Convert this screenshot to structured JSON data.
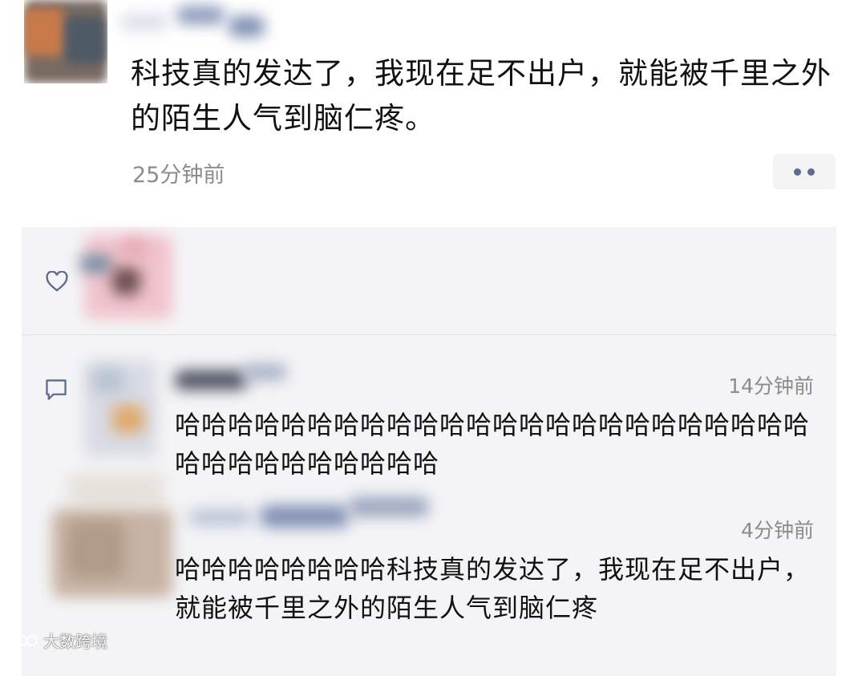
{
  "post": {
    "text": "科技真的发达了，我现在足不出户，就能被千里之外的陌生人气到脑仁疼。",
    "time": "25分钟前"
  },
  "comments": [
    {
      "time": "14分钟前",
      "text": "哈哈哈哈哈哈哈哈哈哈哈哈哈哈哈哈哈哈哈哈哈哈哈哈哈哈哈哈哈哈哈哈哈哈"
    },
    {
      "time": "4分钟前",
      "text": "哈哈哈哈哈哈哈哈科技真的发达了，我现在足不出户，就能被千里之外的陌生人气到脑仁疼"
    }
  ],
  "watermark": {
    "text": "大数跨境"
  },
  "icons": {
    "like": "heart-outline-icon",
    "comment": "comment-bubble-icon",
    "more": "more-dots-icon"
  },
  "colors": {
    "link_blue": "#5c6c8c",
    "timestamp_gray": "#8c8c8c",
    "panel_bg": "#f4f4f6"
  }
}
